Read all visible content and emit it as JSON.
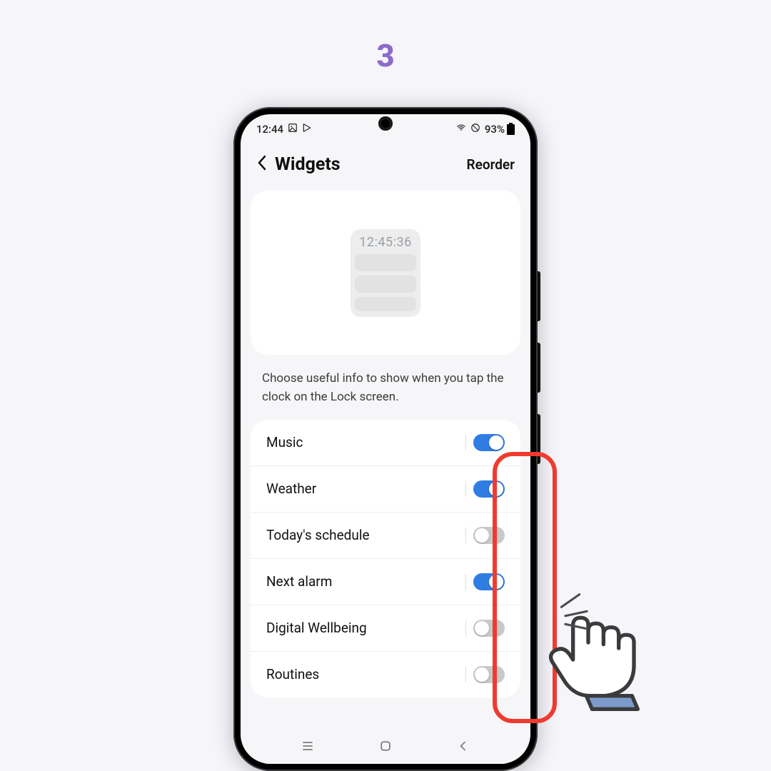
{
  "step_label": "3",
  "statusbar": {
    "time": "12:44",
    "battery": "93%"
  },
  "header": {
    "title": "Widgets",
    "action": "Reorder"
  },
  "preview": {
    "time": "12:45:36"
  },
  "helptext": "Choose useful info to show when you tap the clock on the Lock screen.",
  "widgets": [
    {
      "label": "Music",
      "on": true
    },
    {
      "label": "Weather",
      "on": true
    },
    {
      "label": "Today's schedule",
      "on": false
    },
    {
      "label": "Next alarm",
      "on": true
    },
    {
      "label": "Digital Wellbeing",
      "on": false
    },
    {
      "label": "Routines",
      "on": false
    }
  ]
}
